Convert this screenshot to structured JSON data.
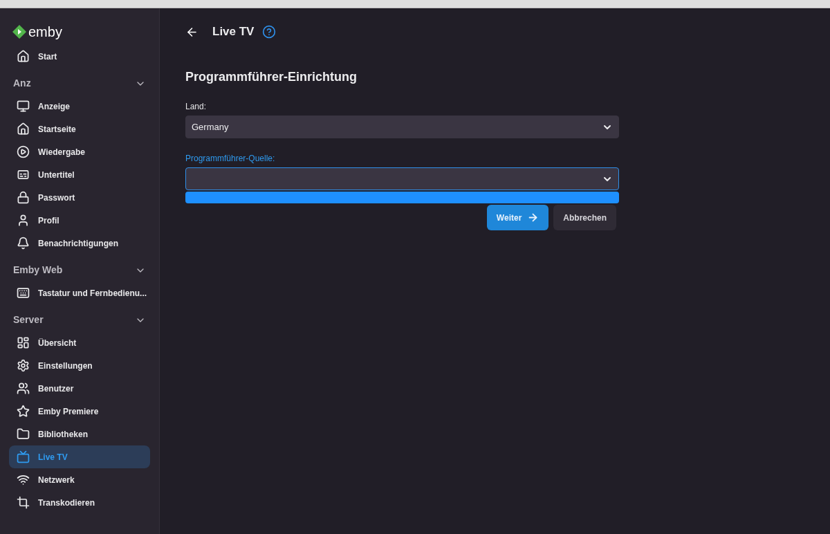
{
  "sidebar": {
    "logo": "emby",
    "start": {
      "label": "Start",
      "selected": false
    },
    "sections": [
      {
        "title": "Anz",
        "expanded": true,
        "items": [
          {
            "label": "Anzeige",
            "selected": false
          },
          {
            "label": "Startseite",
            "selected": false
          },
          {
            "label": "Wiedergabe",
            "selected": false
          },
          {
            "label": "Untertitel",
            "selected": false
          },
          {
            "label": "Passwort",
            "selected": false
          },
          {
            "label": "Profil",
            "selected": false
          },
          {
            "label": "Benachrichtigungen",
            "selected": false
          }
        ]
      },
      {
        "title": "Emby Web",
        "expanded": true,
        "items": [
          {
            "label": "Tastatur und Fernbedienu...",
            "selected": false
          }
        ]
      },
      {
        "title": "Server",
        "expanded": true,
        "items": [
          {
            "label": "Übersicht",
            "selected": false
          },
          {
            "label": "Einstellungen",
            "selected": false
          },
          {
            "label": "Benutzer",
            "selected": false
          },
          {
            "label": "Emby Premiere",
            "selected": false
          },
          {
            "label": "Bibliotheken",
            "selected": false
          },
          {
            "label": "Live TV",
            "selected": true
          },
          {
            "label": "Netzwerk",
            "selected": false
          },
          {
            "label": "Transkodieren",
            "selected": false
          }
        ]
      }
    ]
  },
  "header": {
    "title": "Live TV"
  },
  "form": {
    "title": "Programmführer-Einrichtung",
    "fields": [
      {
        "label": "Land:",
        "value": "Germany",
        "focused": false,
        "open": false
      },
      {
        "label": "Programmführer-Quelle:",
        "focused": true,
        "open": true
      }
    ],
    "buttons": [
      {
        "label": "Weiter",
        "kind": "primary"
      },
      {
        "label": "Abbrechen",
        "kind": "secondary"
      }
    ]
  }
}
